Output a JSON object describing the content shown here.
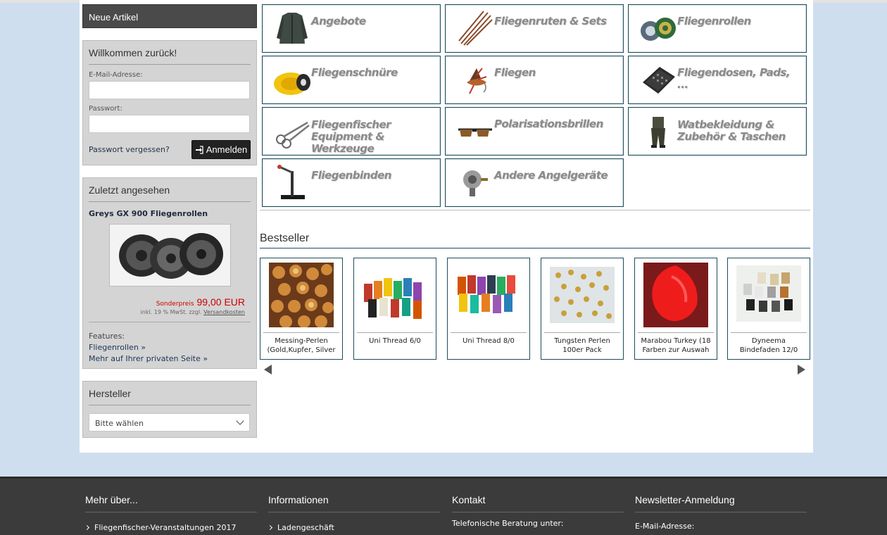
{
  "sidebar": {
    "new_articles": "Neue Artikel",
    "login": {
      "title": "Willkommen zurück!",
      "email_label": "E-Mail-Adresse:",
      "email_value": "",
      "password_label": "Passwort:",
      "password_value": "",
      "forgot": "Passwort vergessen?",
      "submit": "Anmelden"
    },
    "recently_viewed": {
      "title": "Zuletzt angesehen",
      "product_name": "Greys GX 900 Fliegenrollen",
      "special_label": "Sonderpreis",
      "special_price": "99,00 EUR",
      "tax_note": "inkl. 19 % MwSt. zzgl.",
      "shipping_link": "Versandkosten",
      "features_label": "Features:",
      "features_link": "Fliegenrollen »",
      "private_link": "Mehr auf Ihrer privaten Seite »"
    },
    "manufacturer": {
      "title": "Hersteller",
      "select_value": "Bitte wählen"
    }
  },
  "categories": [
    {
      "label": "Angebote",
      "icon": "jacket-icon"
    },
    {
      "label": "Fliegenruten & Sets",
      "icon": "fly-rod-icon"
    },
    {
      "label": "Fliegenrollen",
      "icon": "fly-reel-icon"
    },
    {
      "label": "Fliegenschnüre",
      "icon": "fly-line-icon"
    },
    {
      "label": "Fliegen",
      "icon": "fly-icon"
    },
    {
      "label": "Fliegendosen, Pads, ...",
      "icon": "fly-box-icon"
    },
    {
      "label": "Fliegenfischer Equipment & Werkzeuge",
      "icon": "forceps-icon"
    },
    {
      "label": "Polarisationsbrillen",
      "icon": "sunglasses-icon"
    },
    {
      "label": "Watbekleidung & Zubehör & Taschen",
      "icon": "waders-icon"
    },
    {
      "label": "Fliegenbinden",
      "icon": "vise-icon"
    },
    {
      "label": "Andere Angelgeräte",
      "icon": "spinning-reel-icon"
    }
  ],
  "bestseller": {
    "title": "Bestseller",
    "products": [
      {
        "name": "Messing-Perlen (Gold,Kupfer, Silver",
        "icon": "beads-icon"
      },
      {
        "name": "Uni Thread 6/0",
        "icon": "thread-spools-icon"
      },
      {
        "name": "Uni Thread 8/0",
        "icon": "thread-spools-icon"
      },
      {
        "name": "Tungsten Perlen 100er Pack",
        "icon": "tungsten-beads-icon"
      },
      {
        "name": "Marabou Turkey (18 Farben zur Auswah",
        "icon": "marabou-icon"
      },
      {
        "name": "Dyneema Bindefaden 12/0",
        "icon": "dyneema-spools-icon"
      }
    ]
  },
  "footer": {
    "col1": {
      "title": "Mehr über...",
      "link": "Fliegenfischer-Veranstaltungen 2017"
    },
    "col2": {
      "title": "Informationen",
      "link": "Ladengeschäft"
    },
    "col3": {
      "title": "Kontakt",
      "text": "Telefonische Beratung unter:"
    },
    "col4": {
      "title": "Newsletter-Anmeldung",
      "text": "E-Mail-Adresse:"
    }
  },
  "colors": {
    "tile_border": "#1e4d5a",
    "price_red": "#cc0000",
    "footer_bg": "#3b3b3b",
    "page_bg": "#cfdeee"
  }
}
